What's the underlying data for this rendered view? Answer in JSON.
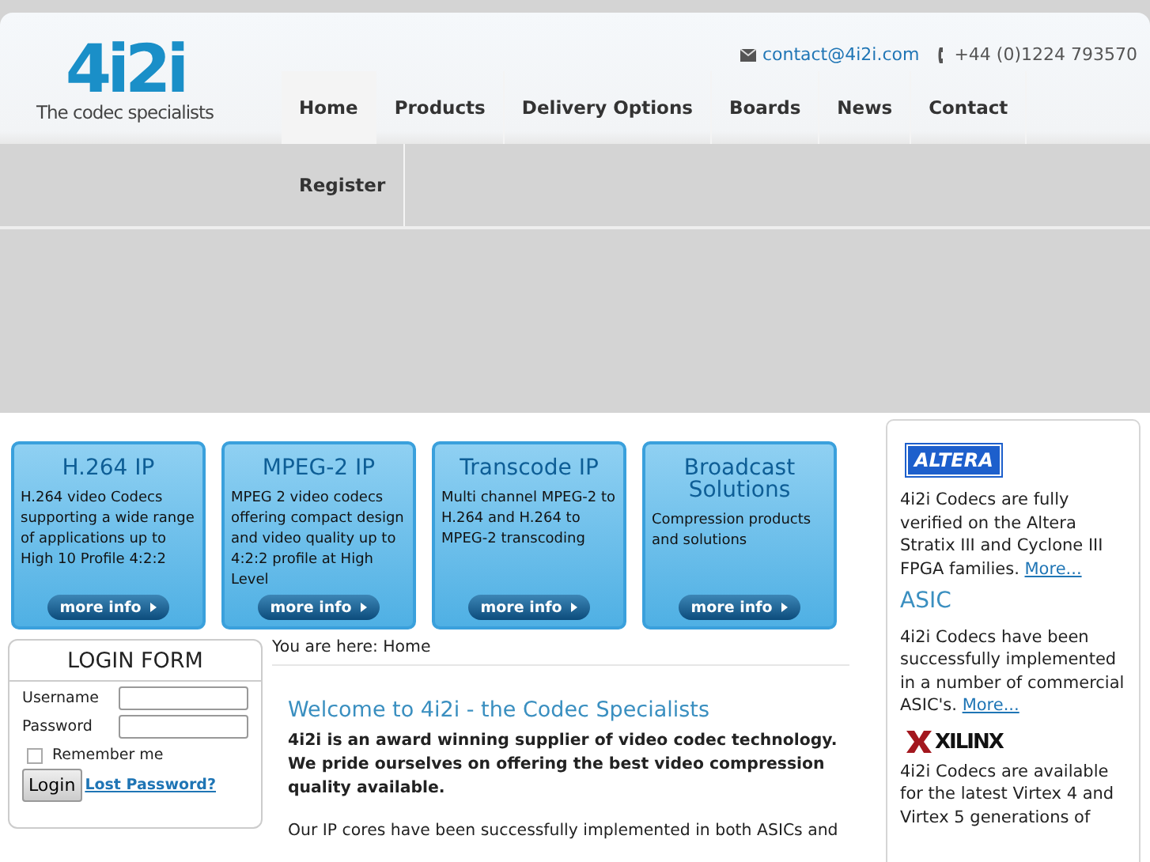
{
  "header": {
    "logo_mark": "4i2i",
    "logo_tagline": "The codec specialists",
    "email": "contact@4i2i.com",
    "phone": "+44 (0)1224 793570"
  },
  "nav": [
    {
      "label": "Home",
      "selected": true
    },
    {
      "label": "Products",
      "selected": false
    },
    {
      "label": "Delivery Options",
      "selected": false
    },
    {
      "label": "Boards",
      "selected": false
    },
    {
      "label": "News",
      "selected": false
    },
    {
      "label": "Contact",
      "selected": false
    },
    {
      "label": "Register",
      "selected": false
    }
  ],
  "product_cards": [
    {
      "title": "H.264 IP",
      "text": "H.264 video Codecs supporting a wide range of applications up to High 10 Profile 4:2:2",
      "button": "more info"
    },
    {
      "title": "MPEG-2 IP",
      "text": "MPEG 2 video codecs offering compact design and video quality up to 4:2:2 profile at High Level",
      "button": "more info"
    },
    {
      "title": "Transcode IP",
      "text": "Multi channel MPEG-2 to H.264 and H.264 to MPEG-2  transcoding",
      "button": "more info"
    },
    {
      "title": "Broadcast Solutions",
      "text": "Compression products and solutions",
      "button": "more info"
    }
  ],
  "login_form": {
    "title": "LOGIN FORM",
    "username_label": "Username",
    "password_label": "Password",
    "remember_label": "Remember me",
    "remember_checked": false,
    "login_button": "Login",
    "lost_password": "Lost Password?"
  },
  "breadcrumb": "You are here: Home",
  "article": {
    "heading": "Welcome to 4i2i - the Codec Specialists",
    "lead": "4i2i is an award winning supplier of video codec technology. We pride ourselves on offering the best video compression quality available.",
    "paragraph": "Our IP cores have been successfully implemented in both ASICs and"
  },
  "sidebar": [
    {
      "kind": "logo",
      "logo": "ALTERA",
      "text": "4i2i Codecs are fully verified on the Altera Stratix III and Cyclone III FPGA families.",
      "link": "More..."
    },
    {
      "kind": "heading",
      "heading": "ASIC",
      "text": "4i2i Codecs have been successfully implemented in a number of commercial ASIC's.",
      "link": "More..."
    },
    {
      "kind": "logo2",
      "logo": "XILINX",
      "text": "4i2i Codecs are available for the latest Virtex 4 and Virtex 5 generations of"
    }
  ]
}
